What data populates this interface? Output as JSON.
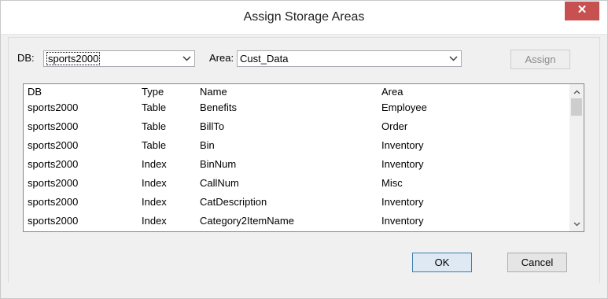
{
  "window": {
    "title": "Assign Storage Areas",
    "close_glyph": "✕"
  },
  "toolbar": {
    "db_label": "DB:",
    "db_value": "sports2000",
    "area_label": "Area:",
    "area_value": "Cust_Data",
    "assign_label": "Assign",
    "assign_enabled": false
  },
  "table": {
    "columns": [
      "DB",
      "Type",
      "Name",
      "Area"
    ],
    "rows": [
      {
        "db": "sports2000",
        "type": "Table",
        "name": "Benefits",
        "area": "Employee"
      },
      {
        "db": "sports2000",
        "type": "Table",
        "name": "BillTo",
        "area": "Order"
      },
      {
        "db": "sports2000",
        "type": "Table",
        "name": "Bin",
        "area": "Inventory"
      },
      {
        "db": "sports2000",
        "type": "Index",
        "name": "BinNum",
        "area": "Inventory"
      },
      {
        "db": "sports2000",
        "type": "Index",
        "name": "CallNum",
        "area": "Misc"
      },
      {
        "db": "sports2000",
        "type": "Index",
        "name": "CatDescription",
        "area": "Inventory"
      },
      {
        "db": "sports2000",
        "type": "Index",
        "name": "Category2ItemName",
        "area": "Inventory"
      }
    ]
  },
  "footer": {
    "ok_label": "OK",
    "cancel_label": "Cancel"
  },
  "icons": {
    "combo_arrow": "chevron-down-icon",
    "scroll_up": "chevron-up-icon",
    "scroll_down": "chevron-down-icon",
    "close": "close-icon"
  },
  "colors": {
    "close_button": "#c75050",
    "default_button_border": "#3c7fb1",
    "dialog_background": "#f0f0f0"
  }
}
